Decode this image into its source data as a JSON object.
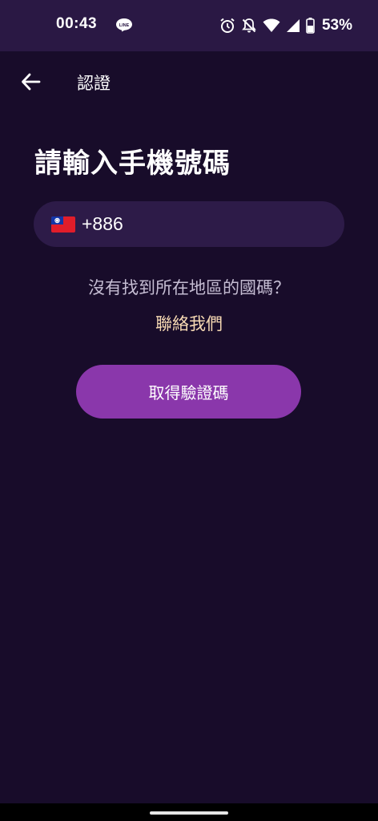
{
  "status_bar": {
    "time": "00:43",
    "notification_icon": "line-app-icon",
    "icons": [
      "alarm-icon",
      "notifications-off-icon",
      "wifi-icon",
      "cell-signal-icon",
      "battery-icon"
    ],
    "battery_percent": "53%"
  },
  "app_bar": {
    "back_icon": "arrow-left-icon",
    "title": "認證"
  },
  "main": {
    "heading": "請輸入手機號碼",
    "phone_input": {
      "flag_icon": "taiwan-flag-icon",
      "country_code": "+886"
    },
    "help_text": "沒有找到所在地區的國碼？",
    "contact_link": "聯絡我們",
    "submit_label": "取得驗證碼"
  },
  "colors": {
    "background": "#180c2a",
    "status_bar": "#2a1844",
    "input_background": "#2d1b48",
    "accent_button": "#8a37ab",
    "link": "#f6d9b3",
    "help_text": "#c5bdd3"
  }
}
